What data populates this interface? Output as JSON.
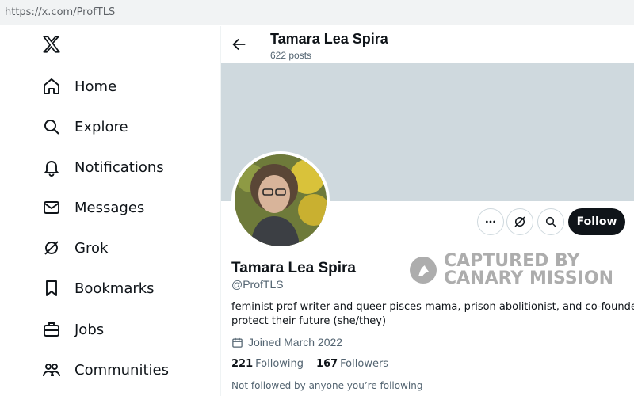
{
  "browser": {
    "url": "https://x.com/ProfTLS"
  },
  "sidebar": {
    "items": [
      {
        "label": "Home",
        "icon": "home-icon"
      },
      {
        "label": "Explore",
        "icon": "search-icon"
      },
      {
        "label": "Notifications",
        "icon": "bell-icon"
      },
      {
        "label": "Messages",
        "icon": "envelope-icon"
      },
      {
        "label": "Grok",
        "icon": "grok-icon"
      },
      {
        "label": "Bookmarks",
        "icon": "bookmark-icon"
      },
      {
        "label": "Jobs",
        "icon": "briefcase-icon"
      },
      {
        "label": "Communities",
        "icon": "people-icon"
      }
    ]
  },
  "header": {
    "name": "Tamara Lea Spira",
    "posts": "622 posts"
  },
  "profile": {
    "name": "Tamara Lea Spira",
    "handle": "@ProfTLS",
    "bio_line1": "feminist prof writer and queer pisces mama, prison abolitionist, and co-founder of",
    "bio_line2": "protect their future (she/they)",
    "joined": "Joined March 2022",
    "following_count": "221",
    "following_label": "Following",
    "followers_count": "167",
    "followers_label": "Followers",
    "not_followed": "Not followed by anyone you’re following",
    "follow_button": "Follow"
  },
  "watermark": {
    "line1": "CAPTURED BY",
    "line2": "CANARY MISSION"
  },
  "colors": {
    "banner": "#cfd9de",
    "text": "#0f1419",
    "muted": "#536471",
    "follow_bg": "#0f1419"
  }
}
